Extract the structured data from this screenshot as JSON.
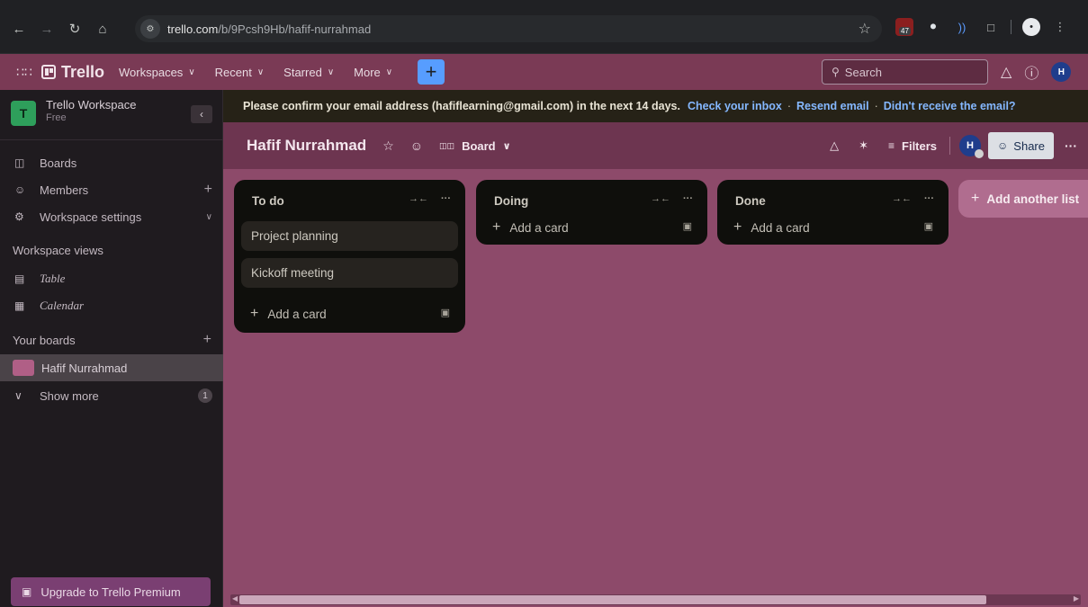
{
  "browser": {
    "url_host": "trello.com",
    "url_path": "/b/9Pcsh9Hb/hafif-nurrahmad",
    "ext_badge": "47",
    "profile_initial": "•"
  },
  "header": {
    "logo_text": "Trello",
    "nav": [
      {
        "label": "Workspaces"
      },
      {
        "label": "Recent"
      },
      {
        "label": "Starred"
      },
      {
        "label": "More"
      }
    ],
    "create_label": "+",
    "search_placeholder": "Search",
    "avatar_initial": "H"
  },
  "sidebar": {
    "workspace_initial": "T",
    "workspace_name": "Trello Workspace",
    "workspace_plan": "Free",
    "items": [
      {
        "label": "Boards"
      },
      {
        "label": "Members"
      },
      {
        "label": "Workspace settings"
      }
    ],
    "views_heading": "Workspace views",
    "views": [
      {
        "label": "Table"
      },
      {
        "label": "Calendar"
      }
    ],
    "boards_heading": "Your boards",
    "active_board": "Hafif Nurrahmad",
    "show_more": "Show more",
    "show_more_count": "1",
    "upgrade_label": "Upgrade to Trello Premium"
  },
  "banner": {
    "message": "Please confirm your email address (hafiflearning@gmail.com) in the next 14 days.",
    "links": [
      "Check your inbox",
      "Resend email",
      "Didn't receive the email?"
    ]
  },
  "board": {
    "title": "Hafif Nurrahmad",
    "view_label": "Board",
    "filters_label": "Filters",
    "member_initial": "H",
    "share_label": "Share",
    "lists": [
      {
        "title": "To do",
        "cards": [
          "Project planning",
          "Kickoff meeting"
        ],
        "add_label": "Add a card"
      },
      {
        "title": "Doing",
        "cards": [],
        "add_label": "Add a card"
      },
      {
        "title": "Done",
        "cards": [],
        "add_label": "Add a card"
      }
    ],
    "add_list_label": "Add another list"
  },
  "colors": {
    "board_bg": "#8d4a6a",
    "header_bg": "#7a3a55",
    "list_bg": "#0f0f0c",
    "link": "#85b8ff",
    "create_button": "#579dff"
  }
}
